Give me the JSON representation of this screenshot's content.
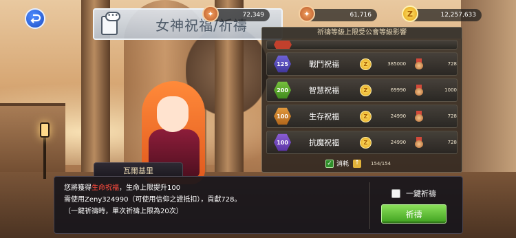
{
  "header": {
    "title": "女神祝福/祈禱",
    "currencies": [
      {
        "icon": "guild-medal-icon",
        "value": "72,349"
      },
      {
        "icon": "locked-medal-icon",
        "value": "61,716"
      },
      {
        "icon": "zeny-coin-icon",
        "value": "12,257,633"
      }
    ]
  },
  "panel": {
    "header": "祈禱等級上限受公會等級影響",
    "blessings": [
      {
        "level": "125",
        "name": "戰鬥祝福",
        "cost": "385000",
        "contribution": "728",
        "color": "blue"
      },
      {
        "level": "200",
        "name": "智慧祝福",
        "cost": "69990",
        "contribution": "1000",
        "color": "green"
      },
      {
        "level": "100",
        "name": "生存祝福",
        "cost": "24990",
        "contribution": "728",
        "color": "orange"
      },
      {
        "level": "100",
        "name": "抗魔祝福",
        "cost": "24990",
        "contribution": "728",
        "color": "purple"
      }
    ],
    "consume": {
      "label": "消耗",
      "value": "154/154"
    }
  },
  "dialog": {
    "npc_name": "瓦爾基里",
    "line1_prefix": "您將獲得",
    "line1_highlight": "生命祝福",
    "line1_suffix": "，生命上限提升100",
    "line2": "需使用Zeny324990（可使用信仰之證抵扣），貢獻728。",
    "line3": "（一鍵祈禱時，單次祈禱上限為20次）",
    "one_key_label": "一鍵祈禱",
    "pray_button": "祈禱"
  },
  "colors": {
    "highlight": "#ff4b3e",
    "pray_button": "#5cc234"
  }
}
